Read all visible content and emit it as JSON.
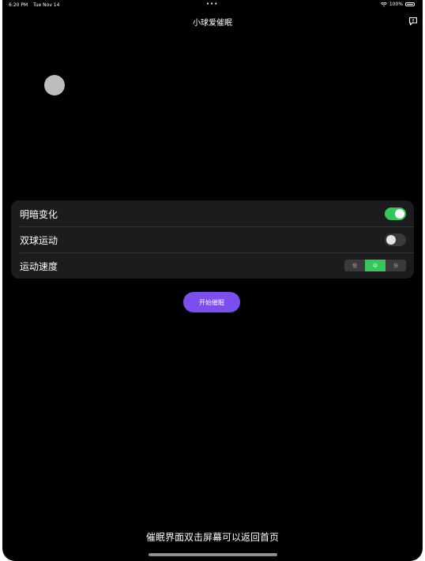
{
  "status_bar": {
    "time": "6:20 PM",
    "date": "Tue Nov 14",
    "multitask_dots": "•••",
    "battery_text": "100%",
    "wifi_icon": "wifi-icon",
    "battery_icon": "battery-icon"
  },
  "nav": {
    "title": "小球爱催眠",
    "feedback_icon": "feedback-icon"
  },
  "ball": {
    "color": "#bdbdbd"
  },
  "settings": {
    "brightness_label": "明暗变化",
    "brightness_on": true,
    "double_ball_label": "双球运动",
    "double_ball_on": false,
    "speed_label": "运动速度",
    "speed_options": [
      "慢",
      "中",
      "快"
    ],
    "speed_selected": "中"
  },
  "start_button": {
    "label": "开始催眠",
    "color": "#7b4ef0"
  },
  "hint": "催眠界面双击屏幕可以返回首页",
  "colors": {
    "toggle_on": "#34c759",
    "background": "#000000",
    "card": "#1c1c1e"
  }
}
